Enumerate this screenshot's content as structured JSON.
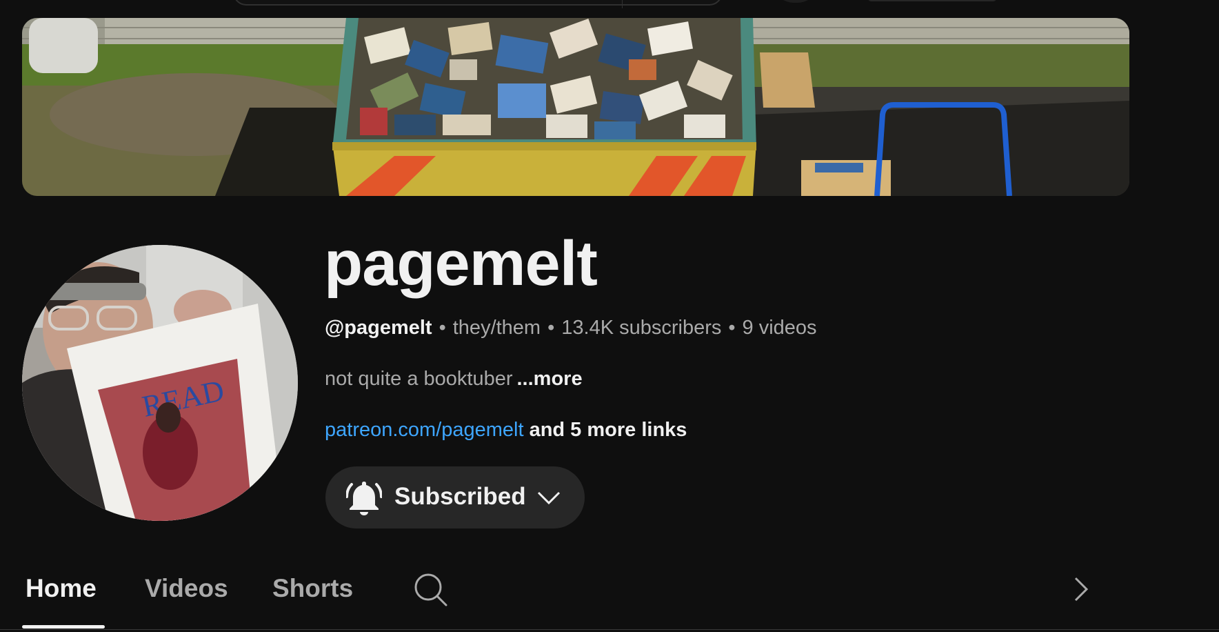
{
  "channel": {
    "name": "pagemelt",
    "handle": "@pagemelt",
    "pronouns": "they/them",
    "subscribers": "13.4K subscribers",
    "videos": "9 videos",
    "separator": "•",
    "description": "not quite a booktuber",
    "description_more": "...more",
    "link": "patreon.com/pagemelt",
    "more_links": "and 5 more links",
    "avatar_sign_text": "READ"
  },
  "subscribe": {
    "label": "Subscribed",
    "bell_icon": "bell-icon",
    "dropdown_icon": "chevron-down-icon"
  },
  "tabs": [
    {
      "label": "Home",
      "active": true
    },
    {
      "label": "Videos",
      "active": false
    },
    {
      "label": "Shorts",
      "active": false
    }
  ],
  "icons": {
    "tab_search": "search-icon",
    "tab_next": "chevron-right-icon"
  },
  "colors": {
    "background": "#0f0f0f",
    "text_primary": "#f1f1f1",
    "text_secondary": "#aaaaaa",
    "link": "#3ea6ff",
    "button_bg": "#272727"
  }
}
